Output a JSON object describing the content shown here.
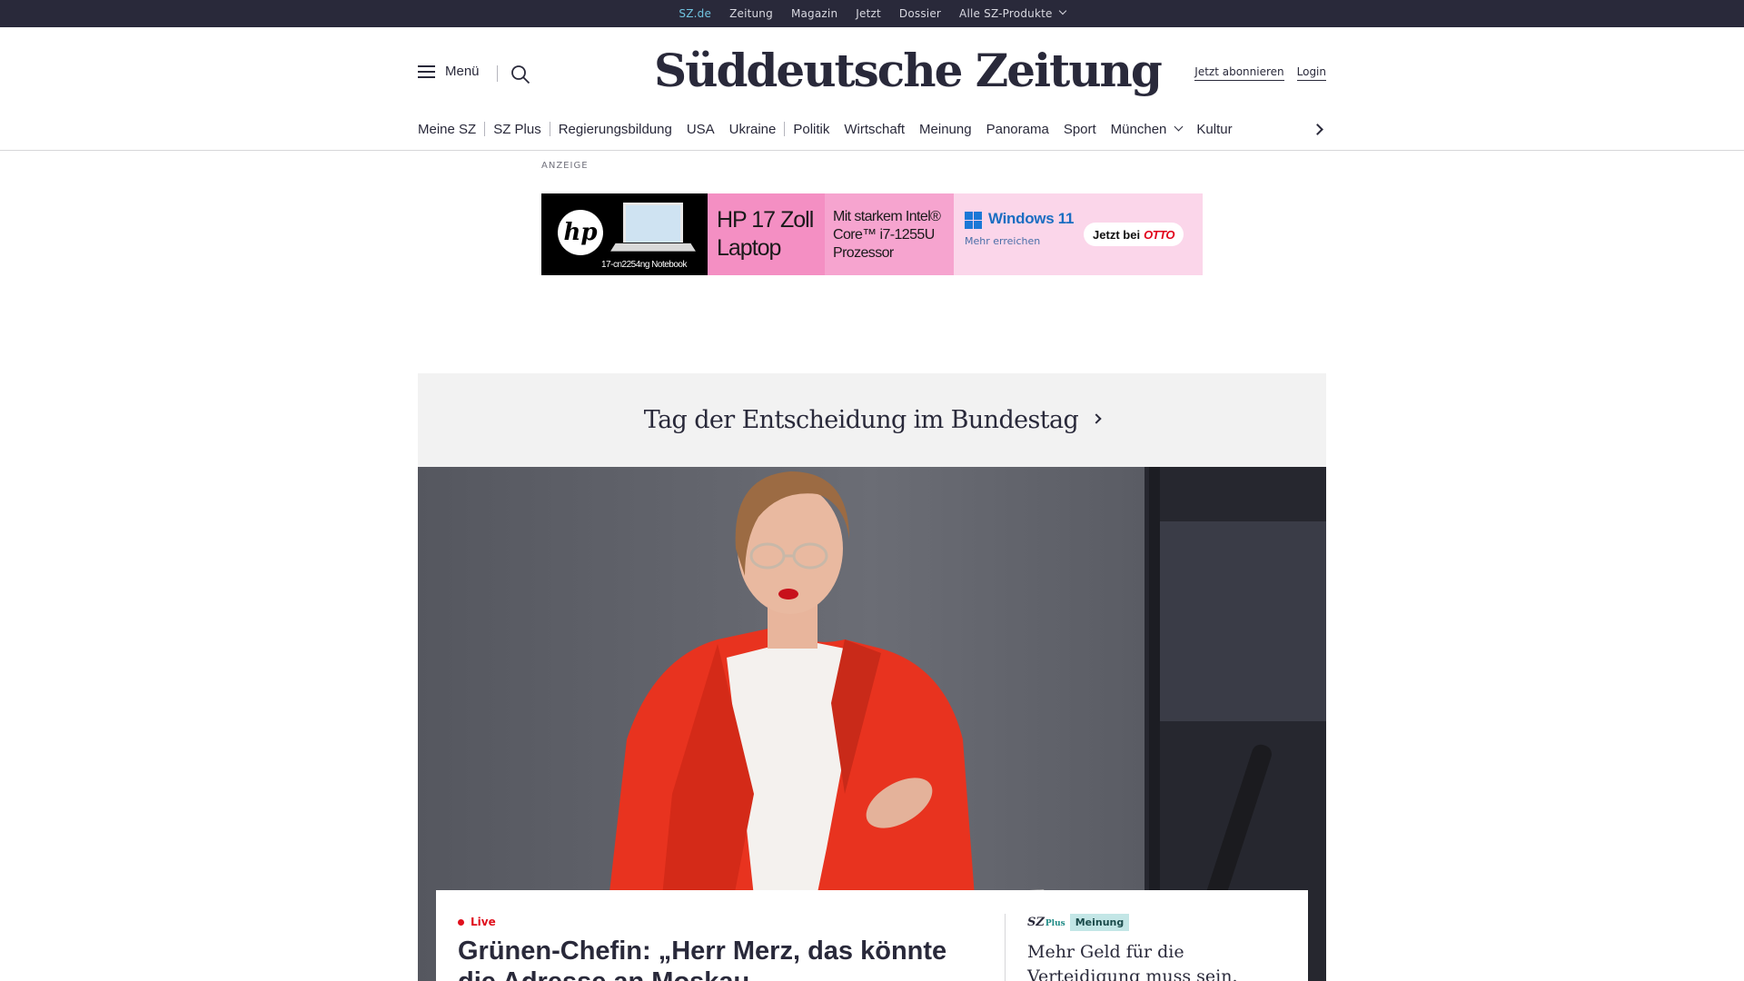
{
  "topbar": {
    "links": [
      "SZ.de",
      "Zeitung",
      "Magazin",
      "Jetzt",
      "Dossier",
      "Alle SZ-Produkte"
    ]
  },
  "header": {
    "menu_label": "Menü",
    "logo": "Süddeutsche Zeitung",
    "subscribe": "Jetzt abonnieren",
    "login": "Login"
  },
  "sections": [
    "Meine SZ",
    "SZ Plus",
    "Regierungsbildung",
    "USA",
    "Ukraine",
    "Politik",
    "Wirtschaft",
    "Meinung",
    "Panorama",
    "Sport",
    "München",
    "Kultur"
  ],
  "ad": {
    "label": "ANZEIGE",
    "model": "17-cn2254ng Notebook",
    "hp_logo": "hp",
    "product": "HP 17 Zoll Laptop",
    "product_line1": "HP 17 Zoll",
    "product_line2": "Laptop",
    "cpu_line1": "Mit starkem Intel®",
    "cpu_line2": "Core™ i7-1255U",
    "cpu_line3": "Prozessor",
    "os": "Windows 11",
    "os_sub": "Mehr erreichen",
    "cta": "Jetzt bei",
    "cta_brand": "OTTO"
  },
  "teaser": {
    "text": "Tag der Entscheidung im Bundestag"
  },
  "story": {
    "live_label": "Live",
    "headline": "Grünen-Chefin: „Herr Merz, das könnte die Adresse an Moskau"
  },
  "side_story": {
    "brand": "SZ",
    "brand_sub": "Plus",
    "tag": "Meinung",
    "title": "Mehr Geld für die Verteidigung muss sein."
  },
  "colors": {
    "topbar_bg": "#29293a",
    "active_link": "#71c4e0",
    "live_red": "#e0101d",
    "teaser_bg": "#f2f2f2",
    "tag_bg": "#c3e6e6"
  }
}
